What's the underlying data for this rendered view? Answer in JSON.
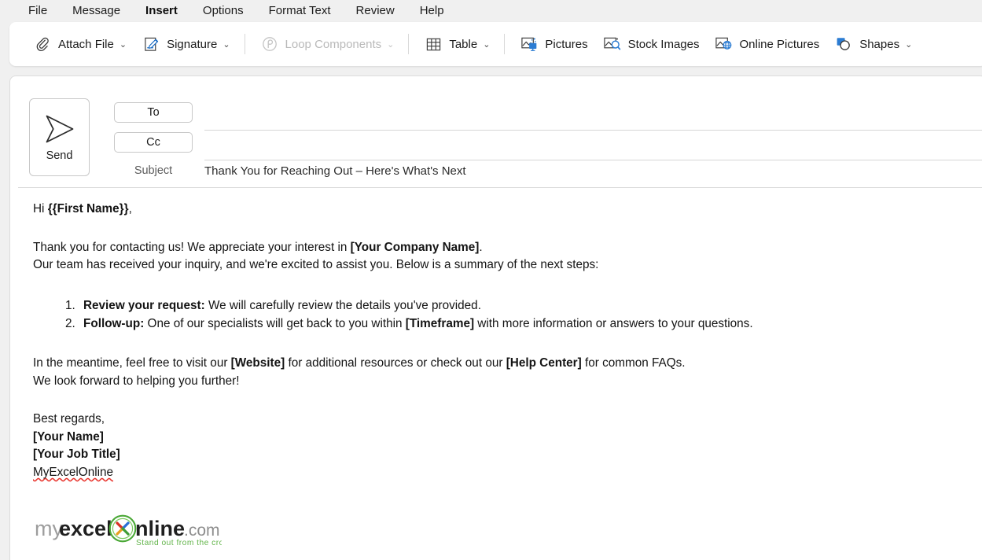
{
  "window": {
    "app": "Outlook Compose",
    "accent_color": "#1668c1",
    "background_color": "#f0f0f0"
  },
  "menu": {
    "tabs": [
      {
        "label": "File",
        "active": false
      },
      {
        "label": "Message",
        "active": false
      },
      {
        "label": "Insert",
        "active": true
      },
      {
        "label": "Options",
        "active": false
      },
      {
        "label": "Format Text",
        "active": false
      },
      {
        "label": "Review",
        "active": false
      },
      {
        "label": "Help",
        "active": false
      }
    ]
  },
  "ribbon": {
    "items": [
      {
        "label": "Attach File",
        "icon": "paperclip-icon",
        "caret": true,
        "disabled": false
      },
      {
        "label": "Signature",
        "icon": "signature-pen-icon",
        "caret": true,
        "disabled": false
      },
      {
        "label": "Loop Components",
        "icon": "loop-components-icon",
        "caret": true,
        "disabled": true
      },
      {
        "label": "Table",
        "icon": "table-grid-icon",
        "caret": true,
        "disabled": false
      },
      {
        "label": "Pictures",
        "icon": "pictures-icon",
        "caret": false,
        "disabled": false
      },
      {
        "label": "Stock Images",
        "icon": "stock-images-icon",
        "caret": false,
        "disabled": false
      },
      {
        "label": "Online Pictures",
        "icon": "online-pictures-icon",
        "caret": false,
        "disabled": false
      },
      {
        "label": "Shapes",
        "icon": "shapes-icon",
        "caret": true,
        "disabled": false
      }
    ]
  },
  "compose": {
    "send_label": "Send",
    "send_icon": "paper-plane-icon",
    "to_label": "To",
    "to_value": "",
    "to_placeholder": "",
    "cc_label": "Cc",
    "cc_value": "",
    "cc_placeholder": "",
    "subject_label": "Subject",
    "subject_value": "Thank You for Reaching Out – Here's What's Next"
  },
  "email_body": {
    "greeting_plain": "Hi ",
    "greeting_bold": "{{First Name}}",
    "greeting_tail": ",",
    "para1_a": "Thank you for contacting us! We appreciate your interest in ",
    "para1_b": "[Your Company Name]",
    "para1_c": ".",
    "para2": "Our team has received your inquiry, and we're excited to assist you. Below is a summary of the next steps:",
    "steps": [
      {
        "number": "1.",
        "bold": "Review your request:",
        "text_a": " We will carefully review the details you've provided.",
        "bold2": "",
        "text_b": ""
      },
      {
        "number": "2.",
        "bold": "Follow-up:",
        "text_a": " One of our specialists will get back to you within ",
        "bold2": "[Timeframe]",
        "text_b": " with more information or answers to your questions."
      }
    ],
    "para3_a": "In the meantime, feel free to visit our ",
    "para3_b": "[Website]",
    "para3_c": " for additional resources or check out our ",
    "para3_d": "[Help Center]",
    "para3_e": " for common FAQs.",
    "para4": "We look forward to helping you further!",
    "signoff": "Best regards,",
    "sig_name": "[Your Name]",
    "sig_title": "[Your Job Title]",
    "sig_company": "MyExcelOnline"
  },
  "logo": {
    "alt": "myexcelonline.com logo",
    "text_my": "my",
    "text_excel": "excel",
    "text_nline": "nline",
    "text_com": ".com",
    "tagline": "Stand out from the crowd",
    "ring_color": "#4aa836",
    "x_colors": [
      "#d93025",
      "#2a6fd6",
      "#e8a020",
      "#3f9c35"
    ],
    "my_color": "#9d9d9d",
    "dark_color": "#1f1f1f",
    "com_color": "#8d8d8d",
    "tagline_color": "#62b44a"
  }
}
